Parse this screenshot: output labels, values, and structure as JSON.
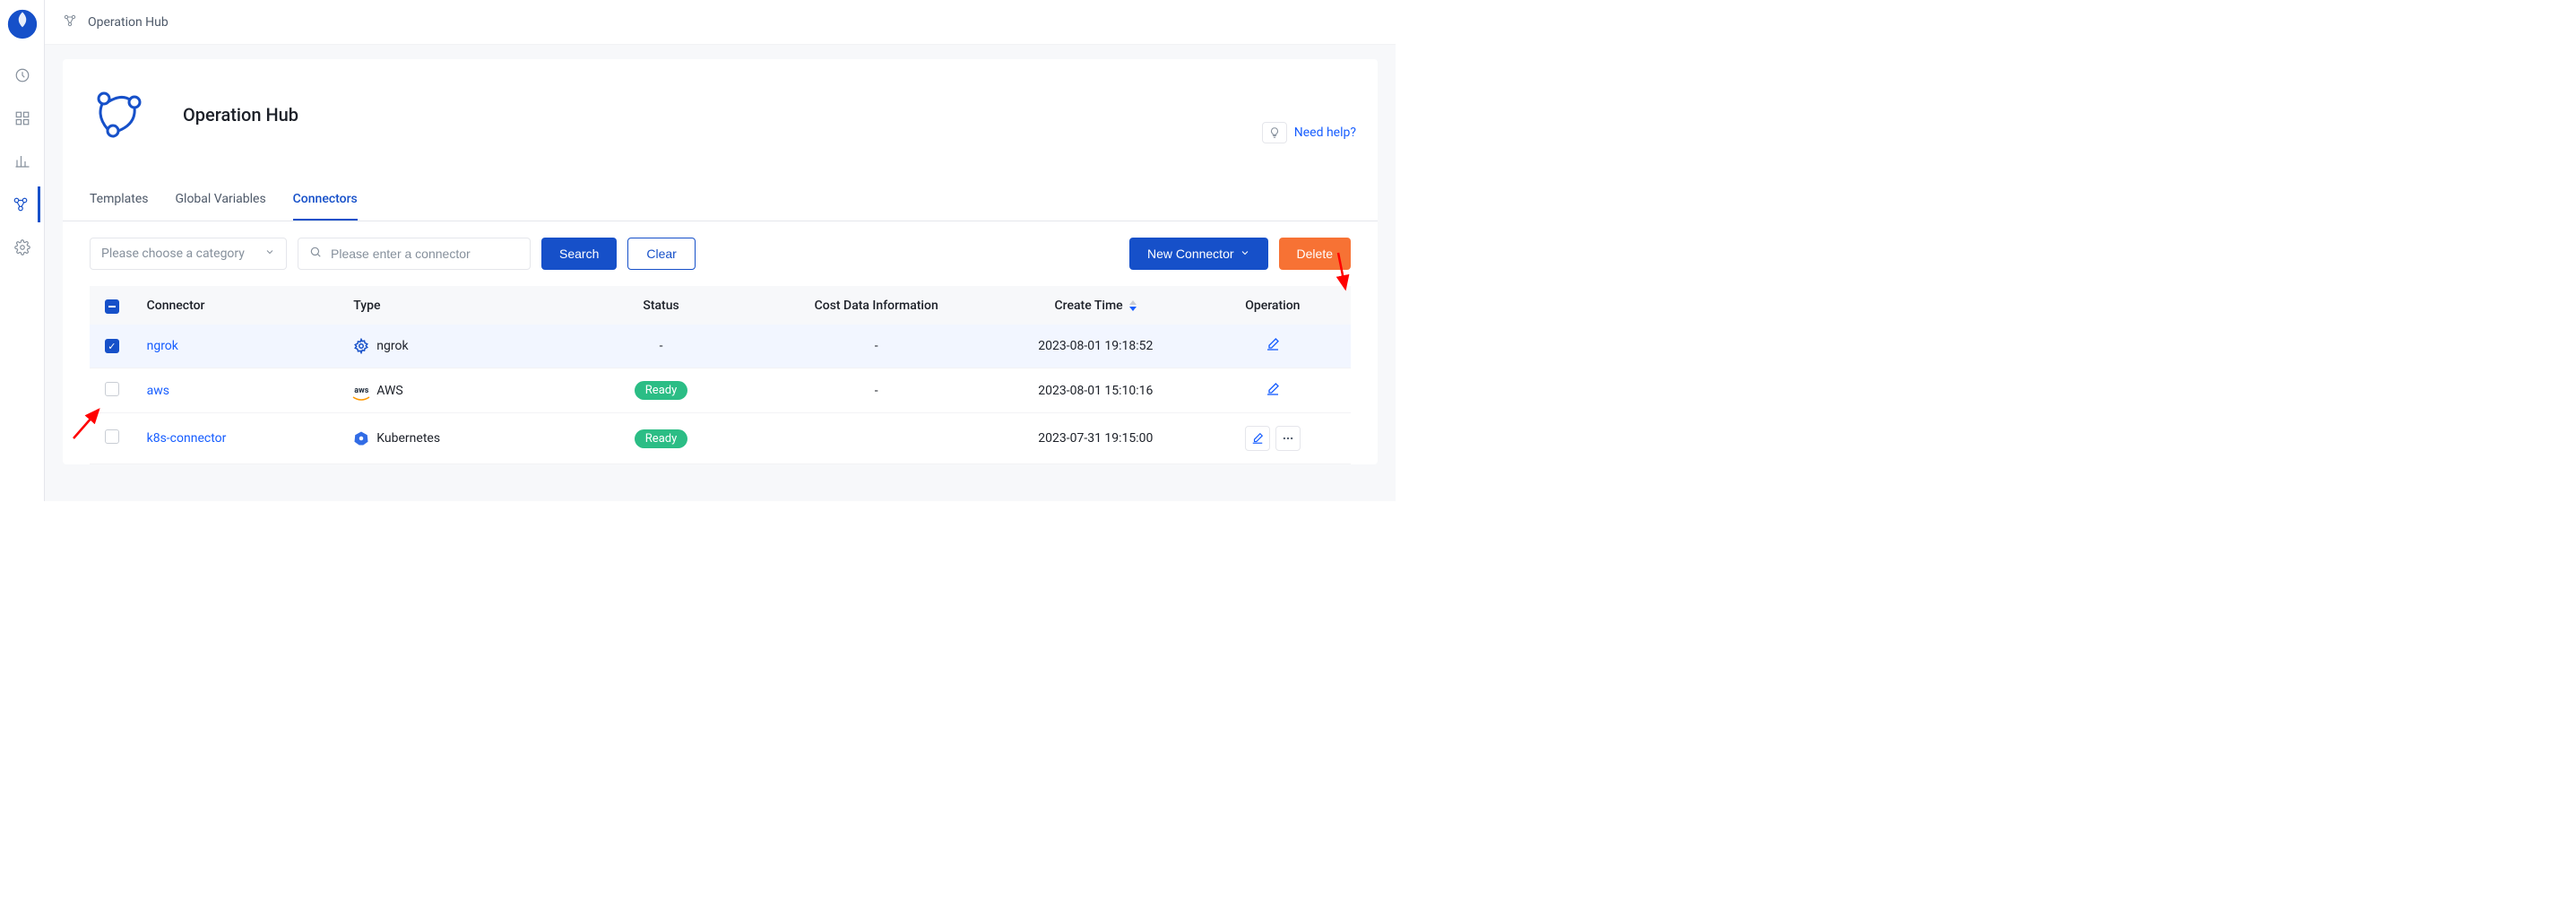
{
  "breadcrumb": {
    "label": "Operation Hub"
  },
  "page": {
    "title": "Operation Hub"
  },
  "help": {
    "label": "Need help?"
  },
  "tabs": [
    {
      "key": "templates",
      "label": "Templates",
      "active": false
    },
    {
      "key": "globalvars",
      "label": "Global Variables",
      "active": false
    },
    {
      "key": "connectors",
      "label": "Connectors",
      "active": true
    }
  ],
  "toolbar": {
    "category_placeholder": "Please choose a category",
    "search_placeholder": "Please enter a connector",
    "search_btn": "Search",
    "clear_btn": "Clear",
    "new_connector_btn": "New Connector",
    "delete_btn": "Delete"
  },
  "table": {
    "headers": {
      "connector": "Connector",
      "type": "Type",
      "status": "Status",
      "cost": "Cost Data Information",
      "create_time": "Create Time",
      "operation": "Operation"
    },
    "rows": [
      {
        "checked": true,
        "connector": "ngrok",
        "type_label": "ngrok",
        "type_icon": "settings-gear-icon",
        "status": "-",
        "cost": "-",
        "create_time": "2023-08-01 19:18:52",
        "ops": [
          "edit"
        ]
      },
      {
        "checked": false,
        "connector": "aws",
        "type_label": "AWS",
        "type_icon": "aws-icon",
        "status": "Ready",
        "cost": "-",
        "create_time": "2023-08-01 15:10:16",
        "ops": [
          "edit"
        ]
      },
      {
        "checked": false,
        "connector": "k8s-connector",
        "type_label": "Kubernetes",
        "type_icon": "kubernetes-icon",
        "status": "Ready",
        "cost": "",
        "create_time": "2023-07-31 19:15:00",
        "ops": [
          "edit",
          "more"
        ]
      }
    ]
  }
}
